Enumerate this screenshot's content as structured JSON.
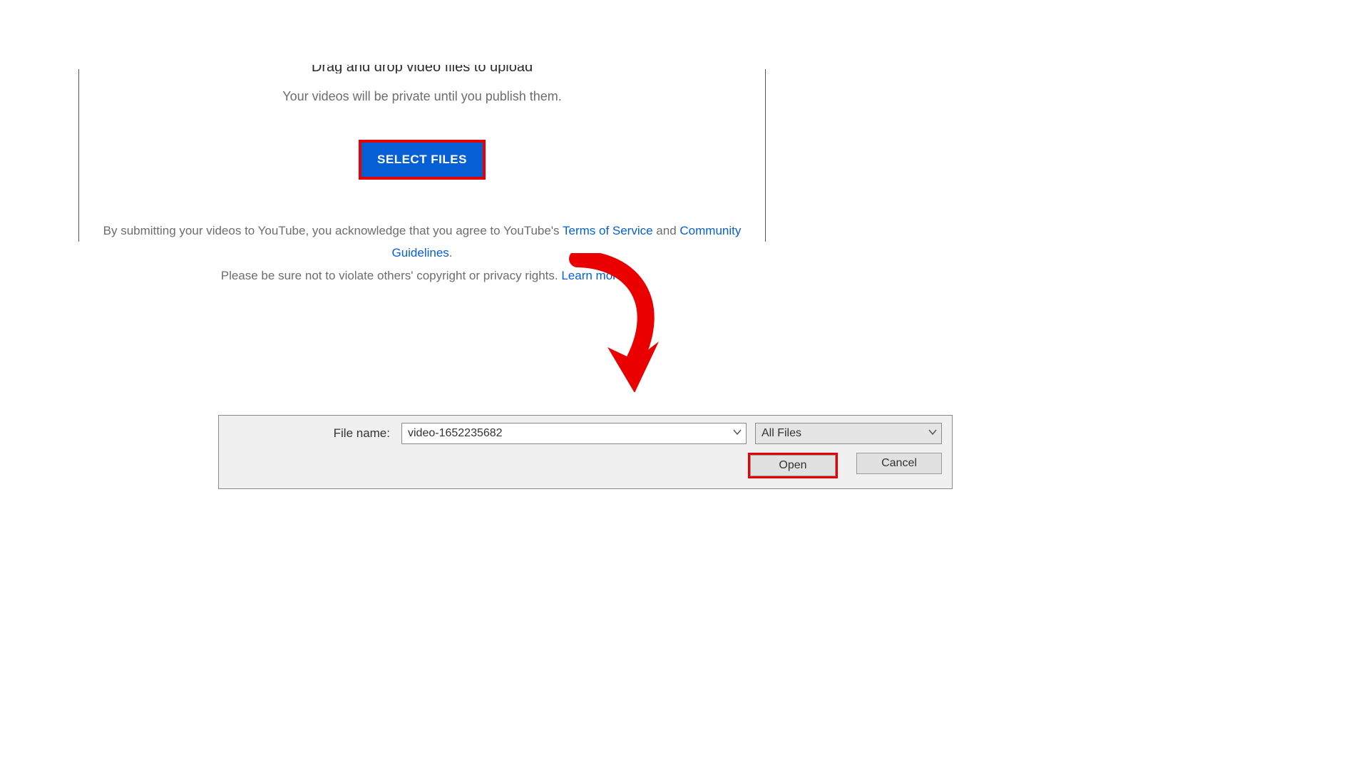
{
  "upload": {
    "drag_line": "Drag and drop video files to upload",
    "private_line": "Your videos will be private until you publish them.",
    "select_files_label": "SELECT FILES",
    "legal_pre": "By submitting your videos to YouTube, you acknowledge that you agree to YouTube's ",
    "terms_link": "Terms of Service",
    "legal_mid": " and ",
    "guidelines_link": "Community Guidelines",
    "legal_post": ".",
    "copyright_line_pre": "Please be sure not to violate others' copyright or privacy rights. ",
    "learn_more_link": "Learn more"
  },
  "dialog": {
    "file_name_label": "File name:",
    "file_name_value": "video-1652235682",
    "file_type_value": "All Files",
    "open_label": "Open",
    "cancel_label": "Cancel"
  },
  "colors": {
    "accent_blue": "#065fd4",
    "highlight_red": "#e60000"
  }
}
